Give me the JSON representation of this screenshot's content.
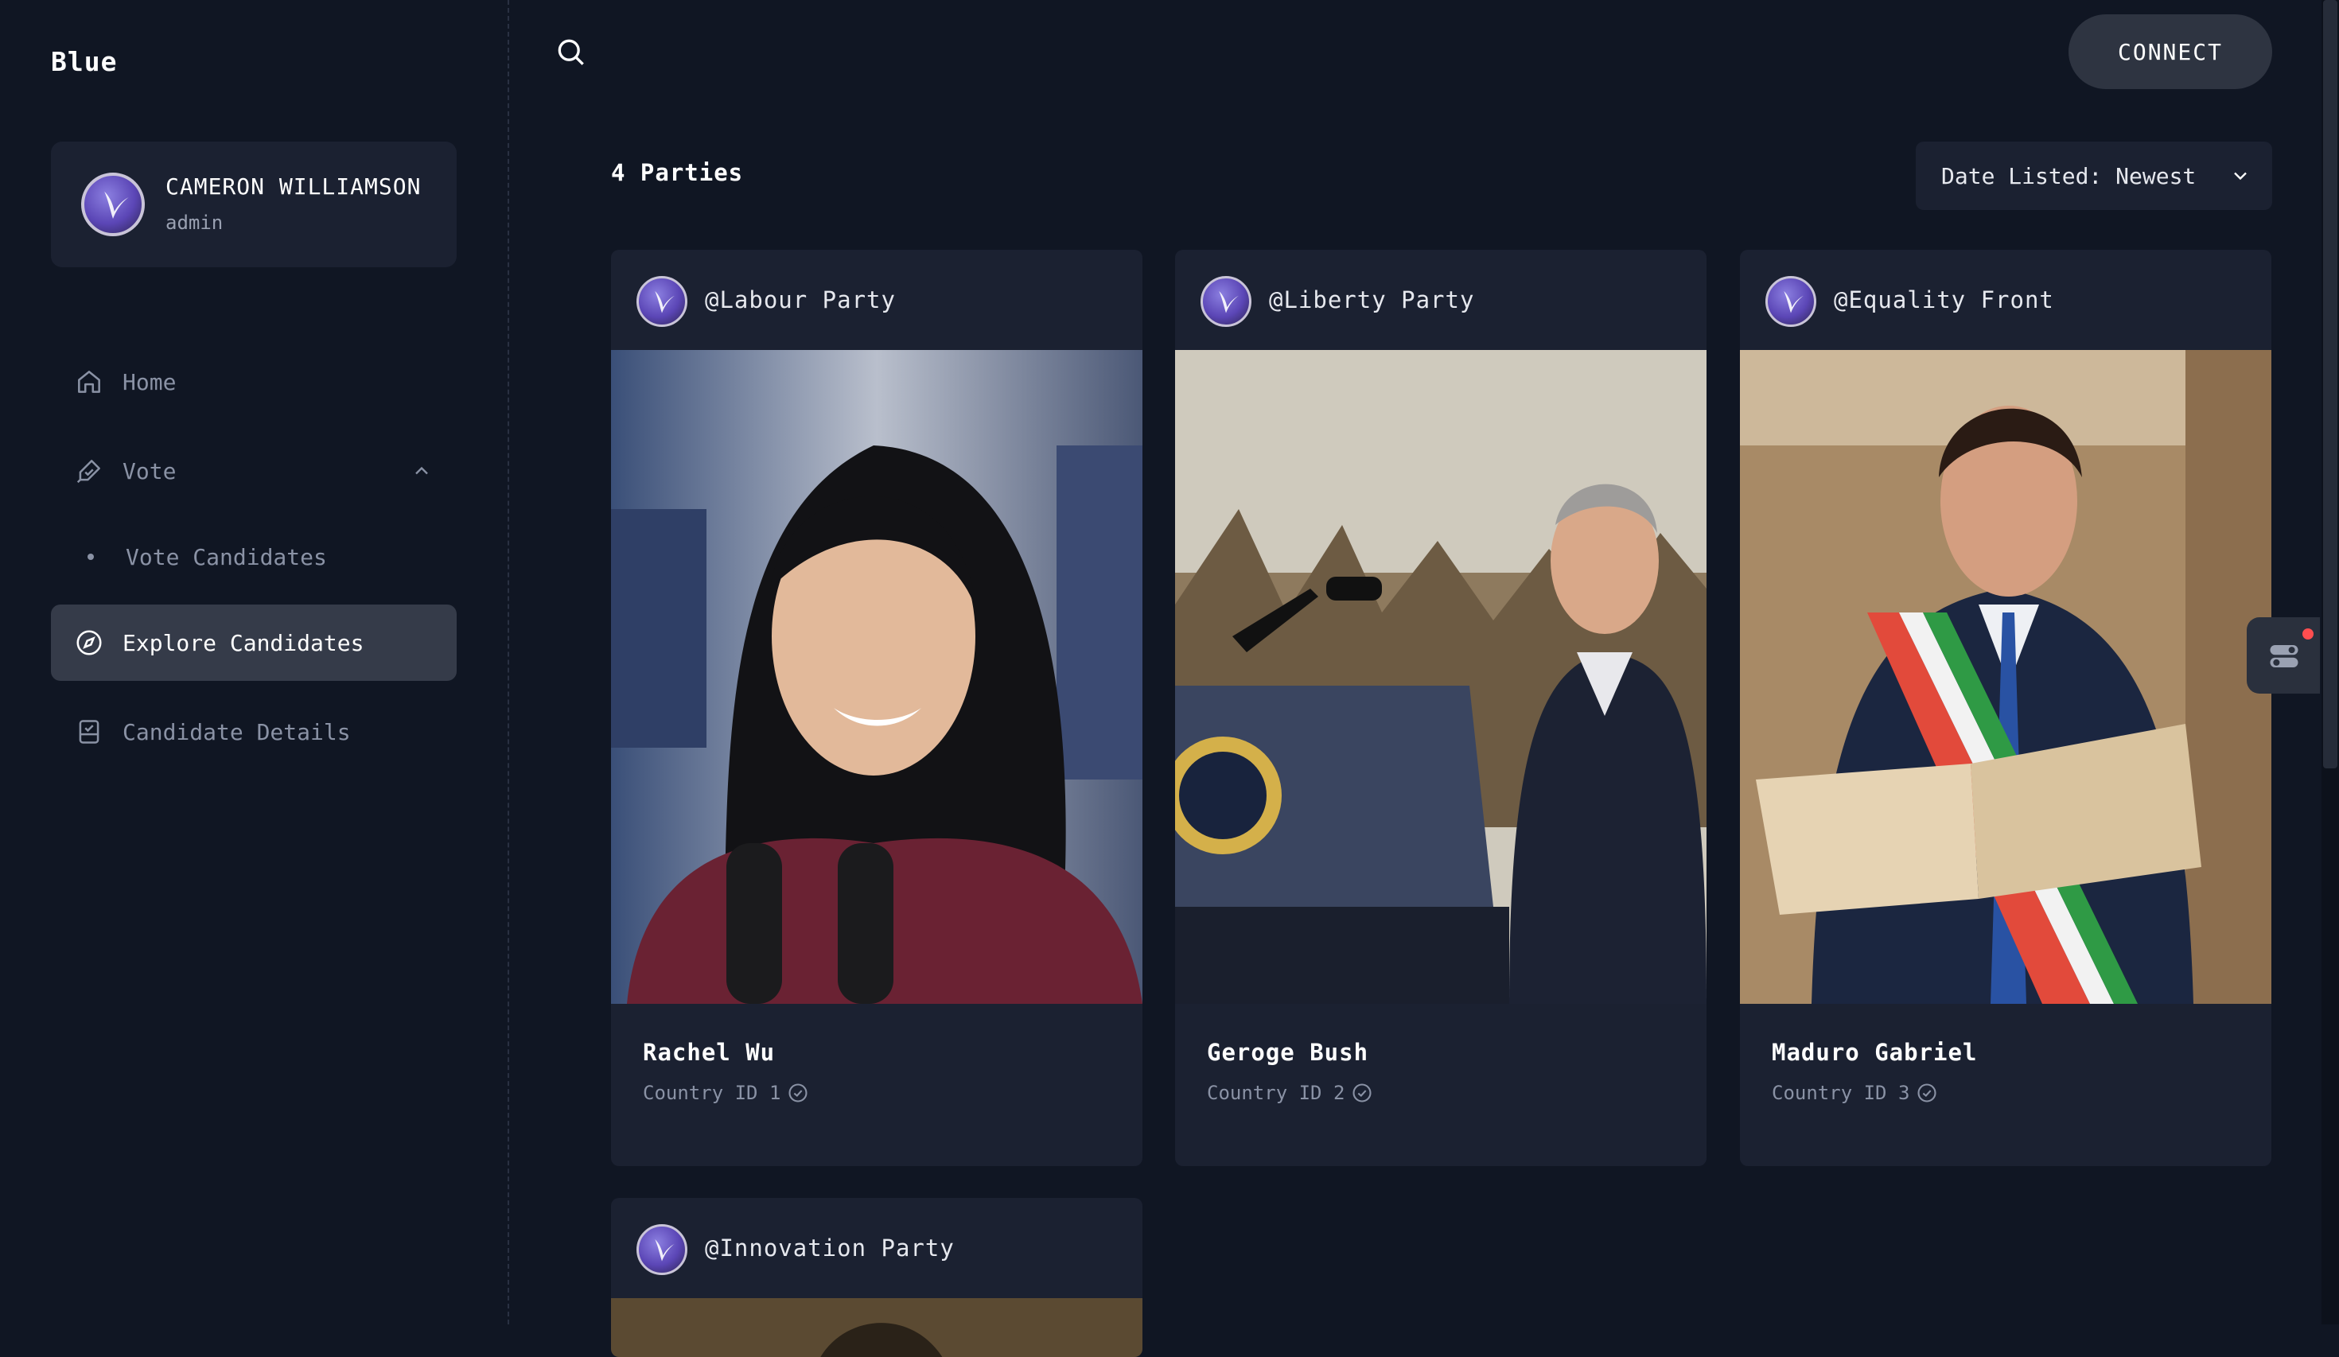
{
  "app": {
    "logo": "Blue"
  },
  "user": {
    "name": "CAMERON WILLIAMSON",
    "role": "admin"
  },
  "sidebar": {
    "items": [
      {
        "label": "Home",
        "icon": "home-icon"
      },
      {
        "label": "Vote",
        "icon": "vote-icon"
      },
      {
        "label": "Vote Candidates",
        "icon": "bullet"
      },
      {
        "label": "Explore Candidates",
        "icon": "compass-icon",
        "active": true
      },
      {
        "label": "Candidate Details",
        "icon": "details-icon"
      }
    ]
  },
  "header": {
    "connect_label": "CONNECT"
  },
  "listing": {
    "count_label": "4 Parties",
    "sort_label": "Date Listed: Newest"
  },
  "cards": [
    {
      "party": "@Labour Party",
      "candidate": "Rachel Wu",
      "country_id": "Country ID 1"
    },
    {
      "party": "@Liberty Party",
      "candidate": "Geroge Bush",
      "country_id": "Country ID 2"
    },
    {
      "party": "@Equality Front",
      "candidate": "Maduro Gabriel",
      "country_id": "Country ID 3"
    },
    {
      "party": "@Innovation Party"
    }
  ],
  "colors": {
    "background": "#101623",
    "card": "#1b2131",
    "active_nav": "#353b49",
    "notification": "#ff4d4f"
  }
}
